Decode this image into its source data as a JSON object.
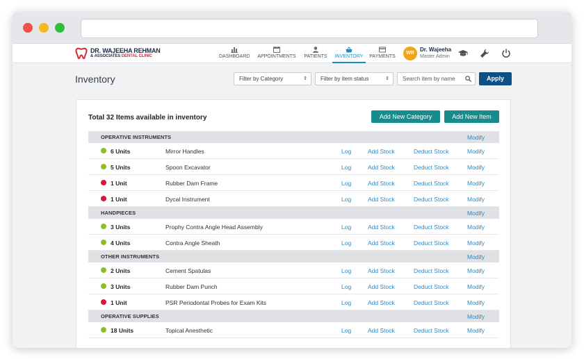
{
  "brand": {
    "line1": "DR. WAJEEHA REHMAN",
    "line2_prefix": "& ASSOCIATES",
    "line2_accent": "DENTAL CLINIC",
    "accent_color": "#d92738"
  },
  "nav": {
    "items": [
      {
        "label": "DASHBOARD",
        "icon": "bar-chart-icon"
      },
      {
        "label": "APPOINTMENTS",
        "icon": "calendar-icon"
      },
      {
        "label": "PATIENTS",
        "icon": "person-icon"
      },
      {
        "label": "INVENTORY",
        "icon": "basket-icon",
        "active": true
      },
      {
        "label": "PAYMENTS",
        "icon": "card-icon"
      }
    ],
    "active_color": "#1f8ac0"
  },
  "user": {
    "initials": "WR",
    "name": "Dr. Wajeeha",
    "role": "Master Admin"
  },
  "page": {
    "title": "Inventory"
  },
  "filters": {
    "category": "Filter by Category",
    "status": "Filter by item status",
    "search_placeholder": "Search item by name",
    "apply": "Apply"
  },
  "card": {
    "title": "Total 32 Items available in inventory",
    "add_category": "Add New Category",
    "add_item": "Add New Item"
  },
  "actions": {
    "log": "Log",
    "add_stock": "Add Stock",
    "deduct_stock": "Deduct Stock",
    "modify": "Modify"
  },
  "status_colors": {
    "in_stock": "#8cbf26",
    "low": "#d9153b"
  },
  "categories": [
    {
      "name": "OPERATIVE INSTRUMENTS",
      "items": [
        {
          "units": "6 Units",
          "name": "Mirror Handles",
          "status": "in_stock"
        },
        {
          "units": "5 Units",
          "name": "Spoon Excavator",
          "status": "in_stock"
        },
        {
          "units": "1 Unit",
          "name": "Rubber Dam Frame",
          "status": "low"
        },
        {
          "units": "1 Unit",
          "name": "Dycal Instrument",
          "status": "low"
        }
      ]
    },
    {
      "name": "HANDPIECES",
      "items": [
        {
          "units": "3 Units",
          "name": "Prophy Contra Angle Head Assembly",
          "status": "in_stock"
        },
        {
          "units": "4 Units",
          "name": "Contra Angle Sheath",
          "status": "in_stock"
        }
      ]
    },
    {
      "name": "OTHER INSTRUMENTS",
      "items": [
        {
          "units": "2 Units",
          "name": "Cement Spatulas",
          "status": "in_stock"
        },
        {
          "units": "3 Units",
          "name": "Rubber Dam Punch",
          "status": "in_stock"
        },
        {
          "units": "1 Unit",
          "name": "PSR Periodontal Probes for Exam Kits",
          "status": "low"
        }
      ]
    },
    {
      "name": "OPERATIVE SUPPLIES",
      "items": [
        {
          "units": "18 Units",
          "name": "Topical Anesthetic",
          "status": "in_stock"
        }
      ]
    }
  ]
}
